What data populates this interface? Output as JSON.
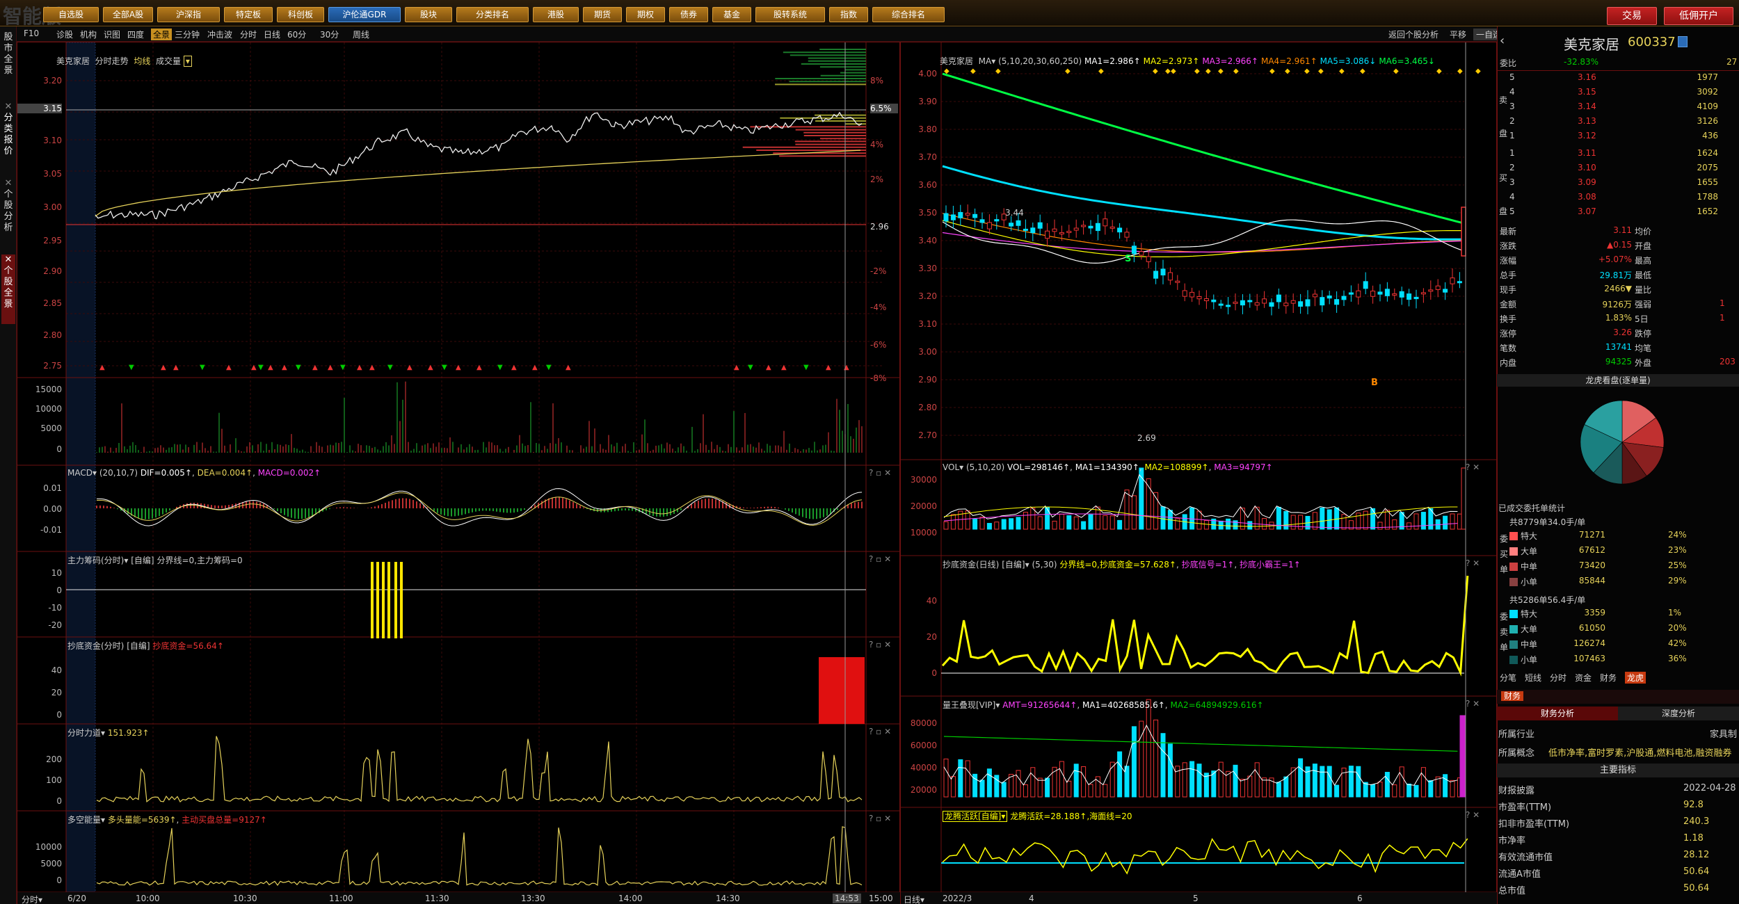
{
  "toolbar": {
    "logo": "智能版",
    "menus": [
      "自选股",
      "全部A股",
      "沪深指",
      "特定板",
      "科创板",
      "沪伦通GDR",
      "股块",
      "分类排名",
      "港股",
      "期货",
      "期权",
      "债券",
      "基金",
      "股转系统",
      "指数",
      "综合排名"
    ],
    "trade_label": "交易",
    "open_account_label": "低佣开户"
  },
  "left_tabs": [
    "股市全景",
    "分类报价",
    "个股分析",
    "个股全景"
  ],
  "subbar": {
    "left": [
      "F10",
      "诊股",
      "机构",
      "识图",
      "四度",
      "全景",
      "三分钟",
      "冲击波",
      "分时",
      "日线",
      "60分",
      "30分",
      "周线"
    ],
    "right_back": "返回个股分析",
    "right_flat": "平移",
    "right_watch": "一自选"
  },
  "intraday": {
    "stock": "美克家居",
    "mode": "分时走势",
    "avg_label": "均线",
    "vol_label": "成交量",
    "y_left": [
      "3.20",
      "3.15",
      "3.10",
      "3.05",
      "3.00",
      "2.95",
      "2.90",
      "2.85",
      "2.80",
      "2.75"
    ],
    "y_right": [
      "8%",
      "6.5%",
      "4%",
      "2%",
      "2.96",
      "-2%",
      "-4%",
      "-6%",
      "-8%"
    ],
    "vol_axis": [
      "15000",
      "10000",
      "5000",
      "0"
    ],
    "macd_title": "MACD",
    "macd_params": "(20,10,7)",
    "macd_dif": "DIF=0.005↑",
    "macd_dea": "DEA=0.004↑",
    "macd_val": "MACD=0.002↑",
    "macd_axis": [
      "0.01",
      "0.00",
      "-0.01"
    ],
    "main_title": "主力筹码(分时)",
    "main_coloring": "[自编]",
    "main_values": "分界线=0,主力筹码=0",
    "main_axis": [
      "10",
      "0",
      "-10",
      "-20"
    ],
    "dip_title": "抄底资金(分时)",
    "dip_coloring": "[自编]",
    "dip_value": "抄底资金=56.64↑",
    "dip_axis": [
      "40",
      "20",
      "0"
    ],
    "force_title": "分时力道",
    "force_value": "151.923↑",
    "force_axis": [
      "200",
      "100",
      "0"
    ],
    "energy_title": "多空能量",
    "energy_bull": "多头量能=5639↑",
    "energy_bear": "主动买盘总量=9127↑",
    "energy_axis": [
      "10000",
      "5000",
      "0"
    ],
    "time_label": "分时",
    "date": "6/20",
    "times": [
      "10:00",
      "10:30",
      "11:00",
      "11:30",
      "13:30",
      "14:00",
      "14:30",
      "14:53",
      "15:00"
    ]
  },
  "daily": {
    "stock": "美克家居",
    "ma_label": "MA",
    "ma_params": "(5,10,20,30,60,250)",
    "ma_vals": [
      "MA1=2.986↑",
      "MA2=2.973↑",
      "MA3=2.966↑",
      "MA4=2.961↑",
      "MA5=3.086↓",
      "MA6=3.465↓"
    ],
    "ma_colors": [
      "#ffffff",
      "#ffff00",
      "#ff44ff",
      "#ff8800",
      "#00e0ff",
      "#00ff44"
    ],
    "y_axis": [
      "4.00",
      "3.90",
      "3.80",
      "3.70",
      "3.60",
      "3.50",
      "3.40",
      "3.30",
      "3.20",
      "3.10",
      "3.00",
      "2.90",
      "2.80",
      "2.70"
    ],
    "high_label": "3.44",
    "low_label": "2.69",
    "s_mark": "S",
    "b_mark": "B",
    "vol_title": "VOL",
    "vol_params": "(5,10,20)",
    "vol_vals": [
      "VOL=298146↑",
      "MA1=134390↑",
      "MA2=108899↑",
      "MA3=94797↑"
    ],
    "vol_axis": [
      "30000",
      "20000",
      "10000"
    ],
    "dip_title": "抄底资金(日线)",
    "dip_coloring": "[自编]",
    "dip_params": "(5,30)",
    "dip_vals": [
      "分界线=0,抄底资金=57.628↑",
      "抄底信号=1↑",
      "抄底小霸王=1↑"
    ],
    "dip_axis": [
      "40",
      "20",
      "0"
    ],
    "king_title": "量王叠现[VIP]",
    "king_vals": [
      "AMT=91265644↑",
      "MA1=40268585.6↑",
      "MA2=64894929.616↑"
    ],
    "king_axis": [
      "80000",
      "60000",
      "40000",
      "20000"
    ],
    "dragon_title": "龙腾活跃[自编]",
    "dragon_vals": "龙腾活跃=28.188↑,海面线=20",
    "period_label": "日线",
    "x_labels": [
      "2022/3",
      "4",
      "5",
      "6"
    ]
  },
  "quote": {
    "name": "美克家居",
    "code": "600337",
    "wei_label": "委比",
    "wei_value": "-32.83%",
    "wei_diff": "27",
    "sell": [
      {
        "lv": "5",
        "p": "3.16",
        "v": "1977"
      },
      {
        "lv": "4",
        "p": "3.15",
        "v": "3092"
      },
      {
        "lv": "3",
        "p": "3.14",
        "v": "4109"
      },
      {
        "lv": "2",
        "p": "3.13",
        "v": "3126"
      },
      {
        "lv": "1",
        "p": "3.12",
        "v": "436"
      }
    ],
    "buy": [
      {
        "lv": "1",
        "p": "3.11",
        "v": "1624"
      },
      {
        "lv": "2",
        "p": "3.10",
        "v": "2075"
      },
      {
        "lv": "3",
        "p": "3.09",
        "v": "1655"
      },
      {
        "lv": "4",
        "p": "3.08",
        "v": "1788"
      },
      {
        "lv": "5",
        "p": "3.07",
        "v": "1652"
      }
    ],
    "sell_label": "卖盘",
    "buy_label": "买盘",
    "stats": [
      {
        "l": "最新",
        "v": "3.11",
        "l2": "均价",
        "v2": ""
      },
      {
        "l": "涨跌",
        "v": "▲0.15",
        "l2": "开盘",
        "v2": ""
      },
      {
        "l": "涨幅",
        "v": "+5.07%",
        "l2": "最高",
        "v2": ""
      },
      {
        "l": "总手",
        "v": "29.81万",
        "l2": "最低",
        "v2": ""
      },
      {
        "l": "现手",
        "v": "2466▼",
        "l2": "量比",
        "v2": ""
      },
      {
        "l": "金额",
        "v": "9126万",
        "l2": "强弱",
        "v2": "1"
      },
      {
        "l": "换手",
        "v": "1.83%",
        "l2": "5日",
        "v2": "1"
      },
      {
        "l": "涨停",
        "v": "3.26",
        "l2": "跌停",
        "v2": ""
      },
      {
        "l": "笔数",
        "v": "13741",
        "l2": "均笔",
        "v2": ""
      },
      {
        "l": "内盘",
        "v": "94325",
        "l2": "外盘",
        "v2": "203"
      }
    ]
  },
  "dragon_pie": {
    "title": "龙虎看盘(逐单量)",
    "slices": [
      {
        "v": 15,
        "c": "#e06060"
      },
      {
        "v": 12,
        "c": "#c03030"
      },
      {
        "v": 13,
        "c": "#8a2020"
      },
      {
        "v": 10,
        "c": "#5a1515"
      },
      {
        "v": 12,
        "c": "#1a5a5a"
      },
      {
        "v": 20,
        "c": "#1a8080"
      },
      {
        "v": 18,
        "c": "#2aa0a0"
      }
    ]
  },
  "order_stats": {
    "title": "已成交委托单统计",
    "buy_total": "共8779单34.0手/单",
    "sell_total": "共5286单56.4手/单",
    "buy_side": "委买单",
    "sell_side": "委卖单",
    "buy_rows": [
      {
        "t": "特大",
        "v": "71271",
        "p": "24%",
        "c": "#ff5050"
      },
      {
        "t": "大单",
        "v": "67612",
        "p": "23%",
        "c": "#ff8080"
      },
      {
        "t": "中单",
        "v": "73420",
        "p": "25%",
        "c": "#cc4040"
      },
      {
        "t": "小单",
        "v": "85844",
        "p": "29%",
        "c": "#884040"
      }
    ],
    "sell_rows": [
      {
        "t": "特大",
        "v": "3359",
        "p": "1%",
        "c": "#00e0ff"
      },
      {
        "t": "大单",
        "v": "61050",
        "p": "20%",
        "c": "#20b0b0"
      },
      {
        "t": "中单",
        "v": "126274",
        "p": "42%",
        "c": "#208080"
      },
      {
        "t": "小单",
        "v": "107463",
        "p": "36%",
        "c": "#105858"
      }
    ]
  },
  "bottom_tabs": [
    "分笔",
    "短线",
    "分时",
    "资金",
    "财务",
    "龙虎"
  ],
  "finance": {
    "header": "财务",
    "tab1": "财务分析",
    "tab2": "深度分析",
    "industry_label": "所属行业",
    "industry": "家具制",
    "concept_label": "所属概念",
    "concept": "低市净率,富时罗素,沪股通,燃料电池,融资融券",
    "main_header": "主要指标",
    "rows": [
      {
        "l": "财报披露",
        "v": "2022-04-28"
      },
      {
        "l": "市盈率(TTM)",
        "v": "92.8"
      },
      {
        "l": "扣非市盈率(TTM)",
        "v": "240.3"
      },
      {
        "l": "市净率",
        "v": "1.18"
      },
      {
        "l": "有效流通市值",
        "v": "28.12"
      },
      {
        "l": "流通A市值",
        "v": "50.64"
      },
      {
        "l": "总市值",
        "v": "50.64"
      }
    ]
  }
}
